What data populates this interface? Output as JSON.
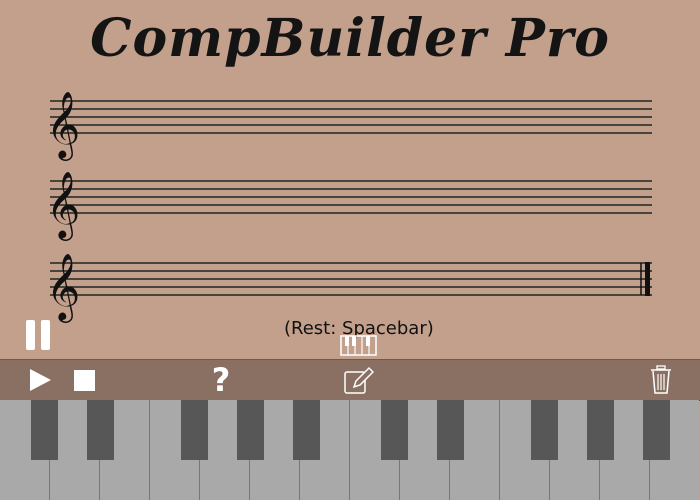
{
  "app": {
    "title": "CompBuilder Pro"
  },
  "hint": "(Rest: Spacebar)",
  "toolbar": {
    "help_label": "?",
    "buttons": [
      "play-icon",
      "stop-icon",
      "help-icon",
      "pencil-icon",
      "trash-icon"
    ]
  },
  "staves": [
    {
      "clef": "treble",
      "final_barline": false
    },
    {
      "clef": "treble",
      "final_barline": false
    },
    {
      "clef": "treble",
      "final_barline": true
    }
  ],
  "piano": {
    "white_keys": 14,
    "black_key_pattern": [
      "C#",
      "D#",
      "F#",
      "G#",
      "A#",
      "C#",
      "D#",
      "F#",
      "G#",
      "A#"
    ]
  },
  "colors": {
    "background": "#c3a08b",
    "toolbar": "#8a7063",
    "white_key": "#a9a9a9",
    "black_key": "#575757"
  }
}
